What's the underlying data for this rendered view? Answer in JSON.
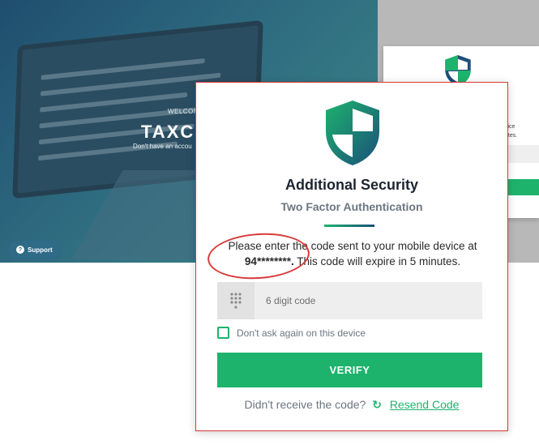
{
  "background": {
    "welcome_label": "WELCOM",
    "brand_label": "TAXCA",
    "signup_hint": "Don't have an accou",
    "support_label": "Support"
  },
  "faded_card": {
    "side_text_1": "vice",
    "side_text_2": "utes."
  },
  "modal": {
    "title": "Additional Security",
    "subtitle": "Two Factor Authentication",
    "message_prefix": "Please enter the code sent to your mobile device at",
    "masked_number": "94********.",
    "message_suffix": "This code will expire in 5 minutes.",
    "code_placeholder": "6 digit code",
    "remember_label": "Don't ask again on this device",
    "remember_checked": false,
    "verify_label": "VERIFY",
    "resend_prompt": "Didn't receive the code?",
    "resend_link": "Resend Code"
  },
  "colors": {
    "accent_green": "#1db36d",
    "shield_blue": "#1c4f7a",
    "annotation_red": "#d93a3a"
  },
  "icons": {
    "shield": "shield-icon",
    "keypad": "keypad-icon",
    "refresh": "refresh-icon",
    "support": "question-icon"
  }
}
